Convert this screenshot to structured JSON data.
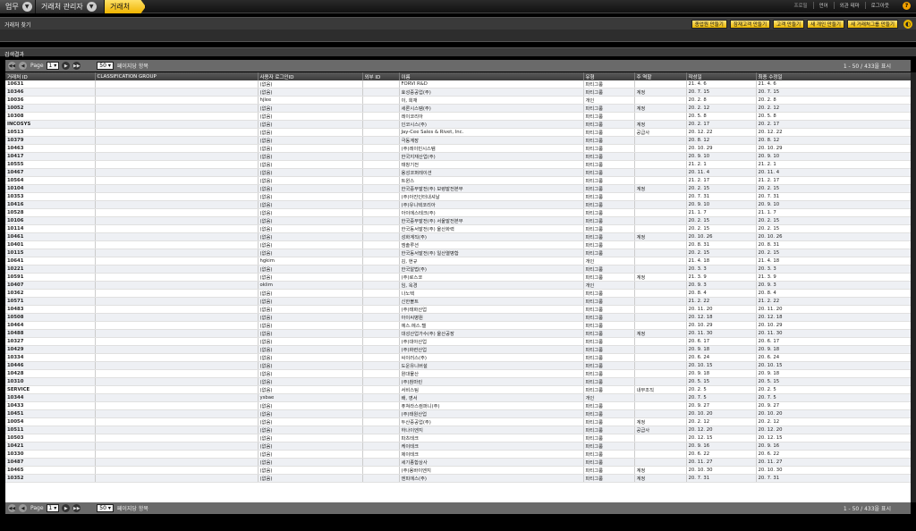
{
  "breadcrumbs": {
    "work": "업무",
    "mgmt": "거래처 관리자",
    "current": "거래처"
  },
  "toplinks": [
    "프로필",
    "언어",
    "외관 테마",
    "로그아웃"
  ],
  "help_label": "?",
  "find": {
    "title": "거래처 찾기",
    "buttons": [
      "종업원 만들기",
      "잠재고객 만들기",
      "고객 만들기",
      "새 개인 만들기",
      "새 거래처그룹 만들기"
    ]
  },
  "results": {
    "title": "검색결과"
  },
  "pager": {
    "page_label": "Page",
    "page_value": "1",
    "size_value": "50",
    "size_label": "페이지당 항목",
    "info": "1 - 50 / 433을 표시"
  },
  "columns": [
    "거래처 ID",
    "CLASSIFICATION GROUP",
    "사용자 로그인ID",
    "외부 ID",
    "이름",
    "유형",
    "주 역할",
    "작성일",
    "최종 수정일"
  ],
  "rows": [
    [
      "10631",
      "",
      "(없음)",
      "",
      "FORVI R&D",
      "파티그룹",
      "",
      "21. 4. 6",
      "21. 4. 6"
    ],
    [
      "10346",
      "",
      "(없음)",
      "",
      "효성중공업(주)",
      "파티그룹",
      "계정",
      "20. 7. 15",
      "20. 7. 15"
    ],
    [
      "10036",
      "",
      "hjlee",
      "",
      "이, 희재",
      "개인",
      "",
      "20. 2. 8",
      "20. 2. 8"
    ],
    [
      "10052",
      "",
      "(없음)",
      "",
      "세론시스템(주)",
      "파티그룹",
      "계정",
      "20. 2. 12",
      "20. 2. 12"
    ],
    [
      "10308",
      "",
      "(없음)",
      "",
      "레이코리아",
      "파티그룹",
      "",
      "20. 5. 8",
      "20. 5. 8"
    ],
    [
      "INCOSYS",
      "",
      "(없음)",
      "",
      "인코시스(주)",
      "파티그룹",
      "계정",
      "20. 2. 17",
      "20. 2. 17"
    ],
    [
      "10513",
      "",
      "(없음)",
      "",
      "Jay-Cee Sales & Rivet, Inc.",
      "파티그룹",
      "공급사",
      "20. 12. 22",
      "20. 12. 22"
    ],
    [
      "10379",
      "",
      "(없음)",
      "",
      "극동계장",
      "파티그룹",
      "",
      "20. 8. 12",
      "20. 8. 12"
    ],
    [
      "10463",
      "",
      "(없음)",
      "",
      "(주)레이민시스템",
      "파티그룹",
      "",
      "20. 10. 29",
      "20. 10. 29"
    ],
    [
      "10417",
      "",
      "(없음)",
      "",
      "한국지재산업(주)",
      "파티그룹",
      "",
      "20. 9. 10",
      "20. 9. 10"
    ],
    [
      "10555",
      "",
      "(없음)",
      "",
      "태창기전",
      "파티그룹",
      "",
      "21. 2. 1",
      "21. 2. 1"
    ],
    [
      "10467",
      "",
      "(없음)",
      "",
      "용성코퍼레이션",
      "파티그룹",
      "",
      "20. 11. 4",
      "20. 11. 4"
    ],
    [
      "10564",
      "",
      "(없음)",
      "",
      "트윈스",
      "파티그룹",
      "",
      "21. 2. 17",
      "21. 2. 17"
    ],
    [
      "10104",
      "",
      "(없음)",
      "",
      "한국중부발전(주) 보령발전본부",
      "파티그룹",
      "계정",
      "20. 2. 15",
      "20. 2. 15"
    ],
    [
      "10353",
      "",
      "(없음)",
      "",
      "(주)아진인터내셔날",
      "파티그룹",
      "",
      "20. 7. 31",
      "20. 7. 31"
    ],
    [
      "10416",
      "",
      "(없음)",
      "",
      "(주)유니텍코리아",
      "파티그룹",
      "",
      "20. 9. 10",
      "20. 9. 10"
    ],
    [
      "10528",
      "",
      "(없음)",
      "",
      "아이에스테크(주)",
      "파티그룹",
      "",
      "21. 1. 7",
      "21. 1. 7"
    ],
    [
      "10106",
      "",
      "(없음)",
      "",
      "한국중부발전(주) 서울발전본부",
      "파티그룹",
      "",
      "20. 2. 15",
      "20. 2. 15"
    ],
    [
      "10114",
      "",
      "(없음)",
      "",
      "한국동서발전(주) 울산화력",
      "파티그룹",
      "",
      "20. 2. 15",
      "20. 2. 15"
    ],
    [
      "10461",
      "",
      "(없음)",
      "",
      "성화계직(주)",
      "파티그룹",
      "계정",
      "20. 10. 26",
      "20. 10. 26"
    ],
    [
      "10401",
      "",
      "(없음)",
      "",
      "엠솔루션",
      "파티그룹",
      "",
      "20. 8. 31",
      "20. 8. 31"
    ],
    [
      "10115",
      "",
      "(없음)",
      "",
      "한국동서발전(주) 일산열병합",
      "파티그룹",
      "",
      "20. 2. 15",
      "20. 2. 15"
    ],
    [
      "10641",
      "",
      "hgkim",
      "",
      "김, 현규",
      "개인",
      "",
      "21. 4. 18",
      "21. 4. 18"
    ],
    [
      "10221",
      "",
      "(없음)",
      "",
      "한국알법(주)",
      "파티그룹",
      "",
      "20. 3. 3",
      "20. 3. 3"
    ],
    [
      "10591",
      "",
      "(없음)",
      "",
      "(주)로스코",
      "파티그룹",
      "계정",
      "21. 3. 9",
      "21. 3. 9"
    ],
    [
      "10407",
      "",
      "oklim",
      "",
      "임, 옥경",
      "개인",
      "",
      "20. 9. 3",
      "20. 9. 3"
    ],
    [
      "10362",
      "",
      "(없음)",
      "",
      "나노텍",
      "파티그룹",
      "",
      "20. 8. 4",
      "20. 8. 4"
    ],
    [
      "10571",
      "",
      "(없음)",
      "",
      "신한볼트",
      "파티그룹",
      "",
      "21. 2. 22",
      "21. 2. 22"
    ],
    [
      "10483",
      "",
      "(없음)",
      "",
      "(주)태화산업",
      "파티그룹",
      "",
      "20. 11. 20",
      "20. 11. 20"
    ],
    [
      "10508",
      "",
      "(없음)",
      "",
      "아이씨병원",
      "파티그룹",
      "",
      "20. 12. 18",
      "20. 12. 18"
    ],
    [
      "10464",
      "",
      "(없음)",
      "",
      "에스.에스.텔",
      "파티그룹",
      "",
      "20. 10. 29",
      "20. 10. 29"
    ],
    [
      "10488",
      "",
      "(없음)",
      "",
      "대성산업가수(주) 울산공장",
      "파티그룹",
      "계정",
      "20. 11. 30",
      "20. 11. 30"
    ],
    [
      "10327",
      "",
      "(없음)",
      "",
      "(주)대아산업",
      "파티그룹",
      "",
      "20. 6. 17",
      "20. 6. 17"
    ],
    [
      "10429",
      "",
      "(없음)",
      "",
      "(주)화련산업",
      "파티그룹",
      "",
      "20. 9. 18",
      "20. 9. 18"
    ],
    [
      "10334",
      "",
      "(없음)",
      "",
      "씨이러스(주)",
      "파티그룹",
      "",
      "20. 6. 24",
      "20. 6. 24"
    ],
    [
      "10446",
      "",
      "(없음)",
      "",
      "도운유니버설",
      "파티그룹",
      "",
      "20. 10. 15",
      "20. 10. 15"
    ],
    [
      "10428",
      "",
      "(없음)",
      "",
      "원대물산",
      "파티그룹",
      "",
      "20. 9. 18",
      "20. 9. 18"
    ],
    [
      "10310",
      "",
      "(없음)",
      "",
      "(주)참마린",
      "파티그룹",
      "",
      "20. 5. 15",
      "20. 5. 15"
    ],
    [
      "SERVICE",
      "",
      "(없음)",
      "",
      "서비스팀",
      "파티그룹",
      "내부조직",
      "20. 2. 5",
      "20. 2. 5"
    ],
    [
      "10344",
      "",
      "ysbae",
      "",
      "배, 영서",
      "개인",
      "",
      "20. 7. 5",
      "20. 7. 5"
    ],
    [
      "10433",
      "",
      "(없음)",
      "",
      "퓨쳐라스컴퍼니(주)",
      "파티그룹",
      "",
      "20. 9. 27",
      "20. 9. 27"
    ],
    [
      "10451",
      "",
      "(없음)",
      "",
      "(주)태원산업",
      "파티그룹",
      "",
      "20. 10. 20",
      "20. 10. 20"
    ],
    [
      "10054",
      "",
      "(없음)",
      "",
      "두산중공업(주)",
      "파티그룹",
      "계정",
      "20. 2. 12",
      "20. 2. 12"
    ],
    [
      "10511",
      "",
      "(없음)",
      "",
      "하나이엔지",
      "파티그룹",
      "공급사",
      "20. 12. 20",
      "20. 12. 20"
    ],
    [
      "10503",
      "",
      "(없음)",
      "",
      "파츠테크",
      "파티그룹",
      "",
      "20. 12. 15",
      "20. 12. 15"
    ],
    [
      "10421",
      "",
      "(없음)",
      "",
      "케이테크",
      "파티그룹",
      "",
      "20. 9. 16",
      "20. 9. 16"
    ],
    [
      "10330",
      "",
      "(없음)",
      "",
      "제이테크",
      "파티그룹",
      "",
      "20. 6. 22",
      "20. 6. 22"
    ],
    [
      "10487",
      "",
      "(없음)",
      "",
      "세기종합상사",
      "파티그룹",
      "",
      "20. 11. 27",
      "20. 11. 27"
    ],
    [
      "10465",
      "",
      "(없음)",
      "",
      "(주)용바이엔지",
      "파티그룹",
      "계정",
      "20. 10. 30",
      "20. 10. 30"
    ],
    [
      "10352",
      "",
      "(없음)",
      "",
      "엔피에스(주)",
      "파티그룹",
      "계정",
      "20. 7. 31",
      "20. 7. 31"
    ]
  ]
}
